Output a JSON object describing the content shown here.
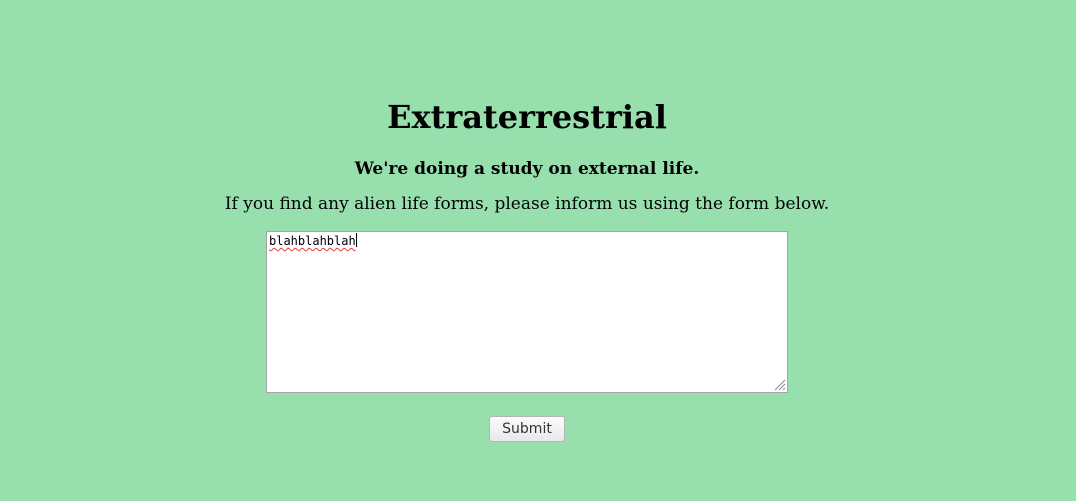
{
  "page": {
    "title": "Extraterrestrial",
    "subtitle": "We're doing a study on external life.",
    "instructions": "If you find any alien life forms, please inform us using the form below."
  },
  "form": {
    "textarea_value": "blahblahblah",
    "submit_label": "Submit"
  },
  "colors": {
    "background": "#98dfae",
    "spellcheck_underline": "#e23c3c"
  },
  "icons": {
    "resize_grip": "resize-grip-icon"
  }
}
